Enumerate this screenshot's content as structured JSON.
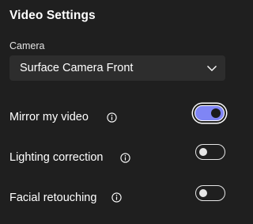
{
  "panel": {
    "title": "Video Settings"
  },
  "camera": {
    "label": "Camera",
    "selected": "Surface Camera Front",
    "chevron_icon": "chevron-down-icon"
  },
  "settings": [
    {
      "label": "Mirror my video",
      "info_icon": "info-icon",
      "enabled": true
    },
    {
      "label": "Lighting correction",
      "info_icon": "info-icon",
      "enabled": false
    },
    {
      "label": "Facial retouching",
      "info_icon": "info-icon",
      "enabled": false
    }
  ],
  "colors": {
    "background": "#1f1f1f",
    "dropdown_bg": "#2d2d2d",
    "toggle_on": "#7f85f5",
    "text": "#ffffff"
  }
}
